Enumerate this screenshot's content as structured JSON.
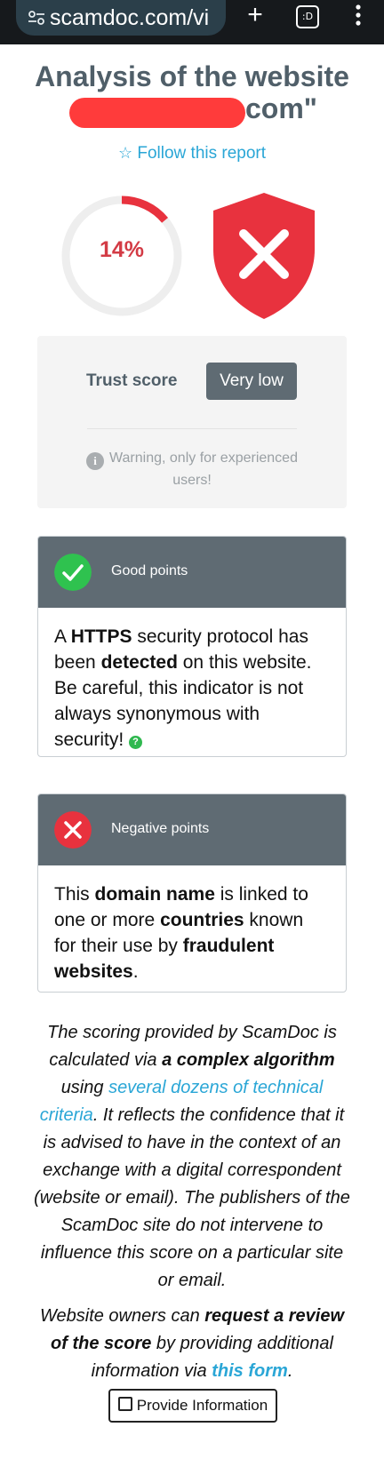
{
  "browser": {
    "url": "scamdoc.com/vi",
    "tab_count_label": ":D"
  },
  "header": {
    "title": "Analysis of the website",
    "domain_suffix": "com\"",
    "follow_label": "Follow this report"
  },
  "score": {
    "percent_label": "14%",
    "percent": 14,
    "trust_label": "Trust score",
    "trust_value": "Very low",
    "warning": "Warning, only for experienced users!"
  },
  "good_points": {
    "title": "Good points",
    "text_1": "A ",
    "bold_1": "HTTPS",
    "text_2": " security protocol has been ",
    "bold_2": "detected",
    "text_3": " on this website. Be careful, this indicator is not always synonymous with security! "
  },
  "negative_points": {
    "title": "Negative points",
    "text_1": "This ",
    "bold_1": "domain name",
    "text_2": " is linked to one or more ",
    "bold_2": "countries",
    "text_3": " known for their use by ",
    "bold_3": "fraudulent websites",
    "text_4": "."
  },
  "explanation": {
    "p1_a": "The scoring provided by ScamDoc is calculated via ",
    "p1_bold": "a complex algorithm",
    "p1_b": " using ",
    "p1_link": "several dozens of technical criteria",
    "p1_c": ". It reflects the confidence that it is advised to have in the context of an exchange with a digital correspondent (website or email). The publishers of the ScamDoc site do not intervene to influence this score on a particular site or email.",
    "p2_a": "Website owners can ",
    "p2_bold": "request a review of the score",
    "p2_b": " by providing additional information via ",
    "p2_link": "this form",
    "p2_c": "."
  },
  "provide_button": "Provide Information",
  "colors": {
    "accent_blue": "#2aa6d6",
    "danger_red": "#e8323e",
    "good_green": "#2fc24f",
    "header_gray": "#5f6b73"
  }
}
